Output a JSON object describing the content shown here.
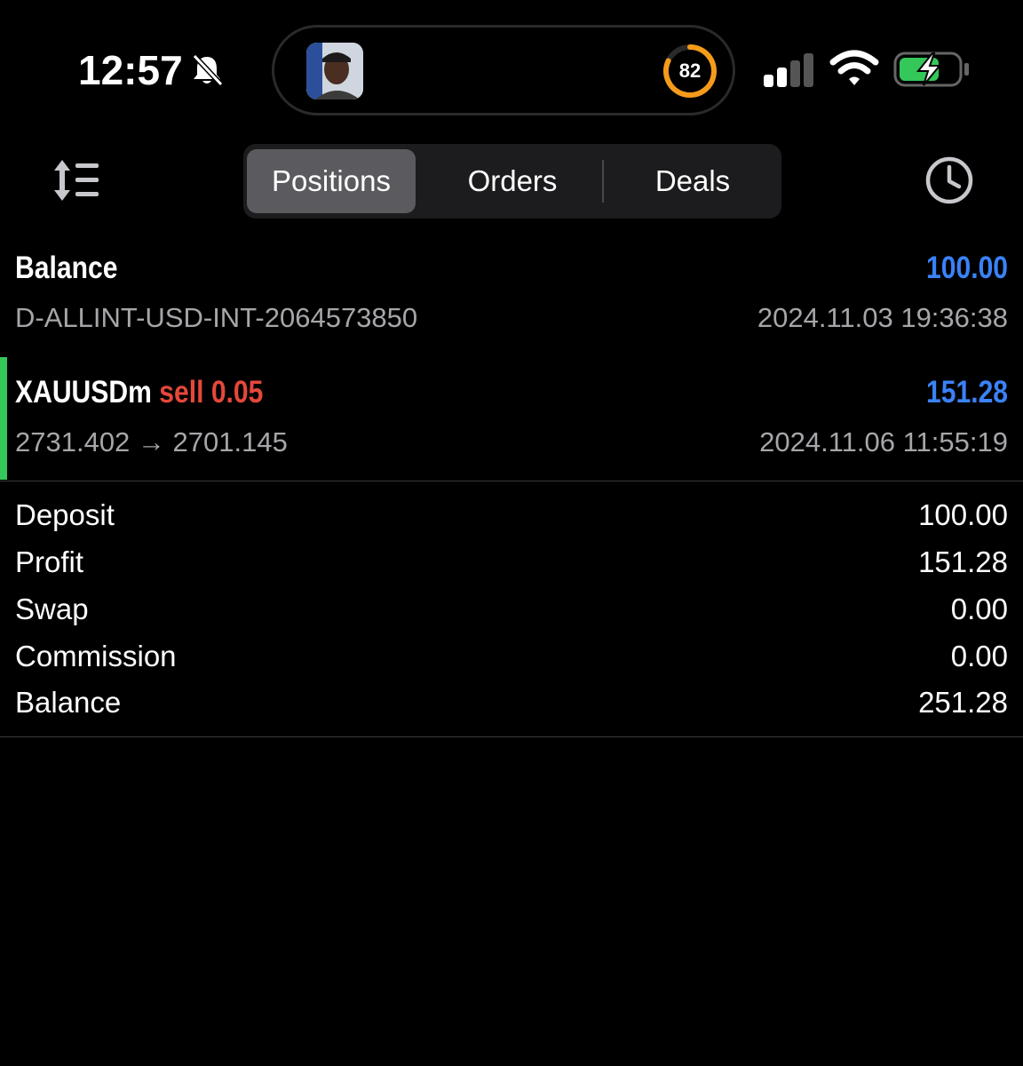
{
  "status_bar": {
    "time": "12:57",
    "island_badge": "82"
  },
  "tabs": [
    {
      "label": "Positions",
      "active": true
    },
    {
      "label": "Orders",
      "active": false
    },
    {
      "label": "Deals",
      "active": false
    }
  ],
  "history": {
    "balance": {
      "title": "Balance",
      "amount": "100.00",
      "account": "D-ALLINT-USD-INT-2064573850",
      "time": "2024.11.03 19:36:38"
    },
    "trade": {
      "symbol": "XAUUSDm",
      "side_volume": "sell 0.05",
      "profit": "151.28",
      "prices": "2731.402 → 2701.145",
      "time": "2024.11.06 11:55:19"
    }
  },
  "summary": {
    "deposit_label": "Deposit",
    "deposit_value": "100.00",
    "profit_label": "Profit",
    "profit_value": "151.28",
    "swap_label": "Swap",
    "swap_value": "0.00",
    "commission_label": "Commission",
    "commission_value": "0.00",
    "balance_label": "Balance",
    "balance_value": "251.28"
  },
  "colors": {
    "background": "#000000",
    "positive_amount": "#3a82f7",
    "sell": "#e5483b",
    "buy_accent": "#34c759",
    "secondary_text": "#a6a6aa"
  },
  "icons": [
    "bell-slash-icon",
    "cellular-signal-icon",
    "wifi-icon",
    "battery-charging-icon",
    "sort-icon",
    "clock-icon"
  ]
}
